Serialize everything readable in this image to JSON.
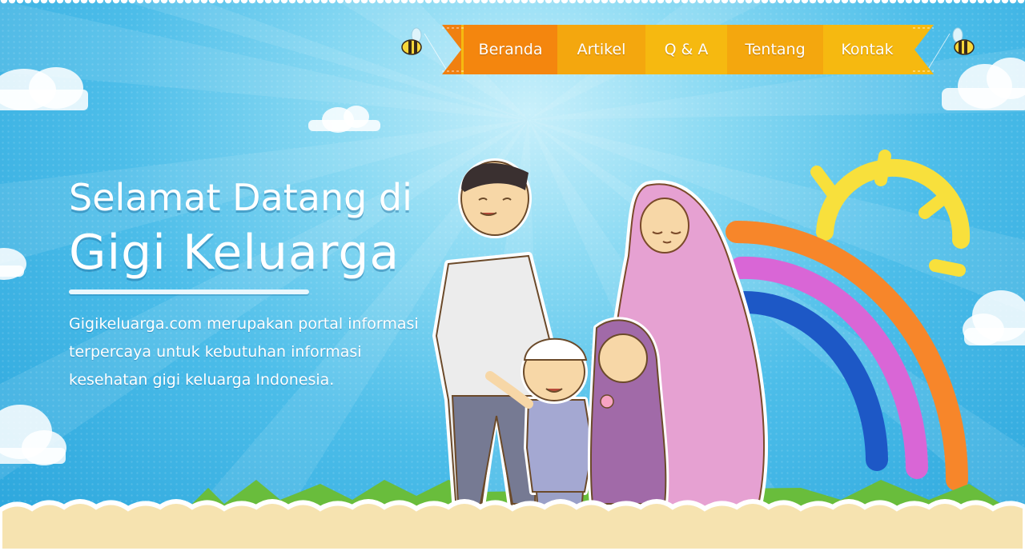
{
  "nav": {
    "items": [
      {
        "label": "Beranda",
        "state": "active"
      },
      {
        "label": "Artikel",
        "state": "normal"
      },
      {
        "label": "Q & A",
        "state": "normal"
      },
      {
        "label": "Tentang",
        "state": "normal"
      },
      {
        "label": "Kontak",
        "state": "normal"
      }
    ]
  },
  "hero": {
    "title_line1": "Selamat Datang di",
    "title_line2": "Gigi Keluarga",
    "description": "Gigikeluarga.com merupakan portal informasi terpercaya untuk kebutuhan informasi kesehatan gigi keluarga Indonesia."
  },
  "icons": [
    "bee-icon",
    "sun-icon",
    "rainbow-icon",
    "cloud-icon",
    "family-illustration"
  ],
  "colors": {
    "sky": "#3fb6e6",
    "nav_active": "#f4860e",
    "nav_normal": "#f6b910",
    "text": "#ffffff",
    "ground": "#f6e3b0"
  }
}
